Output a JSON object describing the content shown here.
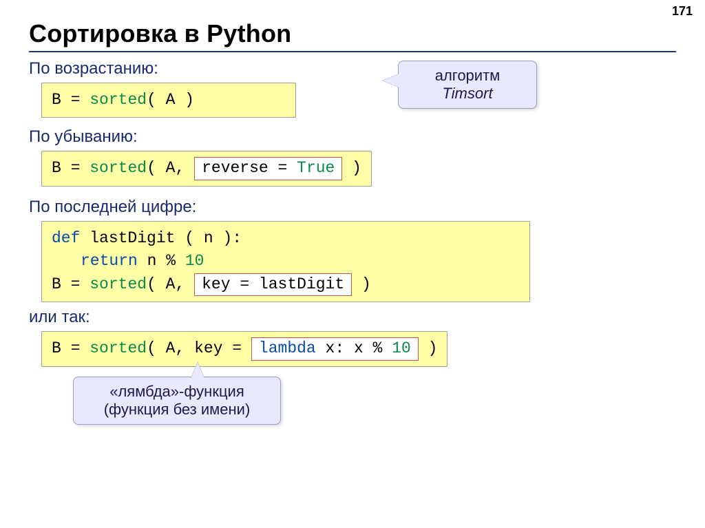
{
  "page_number": "171",
  "title": "Сортировка в Python",
  "sections": {
    "ascending_label": "По возрастанию:",
    "descending_label": "По убыванию:",
    "last_digit_label": "По последней цифре:",
    "or_like_this": "или так:"
  },
  "code": {
    "box1_b": "B",
    "box1_eq": " = ",
    "box1_sorted": "sorted",
    "box1_paren_open": "( ",
    "box1_a": "A",
    "box1_paren_close": " )",
    "box2_b": "B",
    "box2_eq": " = ",
    "box2_sorted": "sorted",
    "box2_po": "( ",
    "box2_a": "A",
    "box2_comma": ", ",
    "box2_pc": " )",
    "inset_reverse": "reverse",
    "inset_reverse_eq": " = ",
    "inset_reverse_true": "True",
    "box3_def": "def",
    "box3_fn": " lastDigit ( n ):",
    "box3_ret": "return",
    "box3_ret_expr": " n % ",
    "box3_ten": "10",
    "box3_b": "B",
    "box3_eq": " = ",
    "box3_sorted": "sorted",
    "box3_po": "( ",
    "box3_a": "A",
    "box3_comma": ", ",
    "box3_pc": " )",
    "inset_key_ld": "key",
    "inset_key_ld_eq": " = ",
    "inset_key_ld_val": "lastDigit",
    "box4_b": "B",
    "box4_eq": " = ",
    "box4_sorted": "sorted",
    "box4_po": "( ",
    "box4_a": "A",
    "box4_key": ", key = ",
    "box4_pc": "  )",
    "inset_lambda_kw": "lambda",
    "inset_lambda_body": " x: x % ",
    "inset_lambda_ten": "10"
  },
  "callouts": {
    "timsort_l1": "алгоритм",
    "timsort_l2": "Timsort",
    "lambda_l1": "«лямбда»-функция",
    "lambda_l2": "(функция без имени)"
  }
}
